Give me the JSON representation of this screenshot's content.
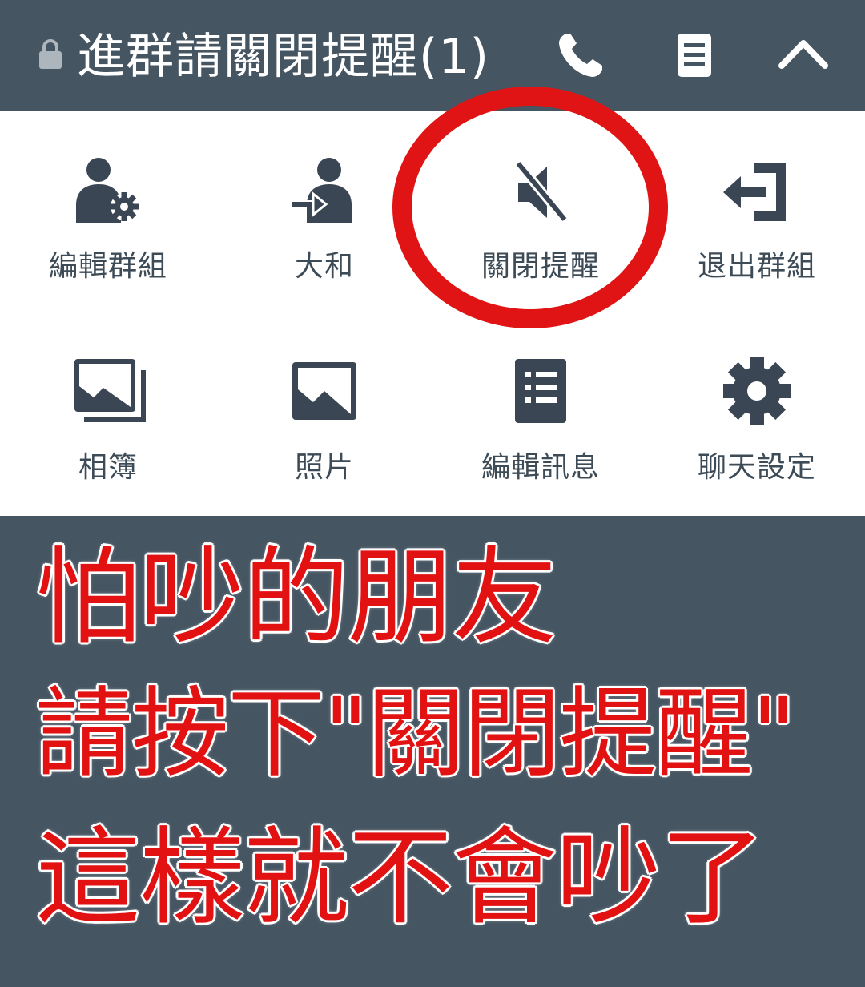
{
  "header": {
    "title": "進群請關閉提醒(1)",
    "icons": [
      "lock-icon",
      "phone-icon",
      "notes-icon",
      "caret-up-icon"
    ]
  },
  "menu": {
    "items": [
      {
        "label": "編輯群組",
        "icon": "edit-group-icon"
      },
      {
        "label": "大和",
        "icon": "invite-person-icon"
      },
      {
        "label": "關閉提醒",
        "icon": "mute-icon"
      },
      {
        "label": "退出群組",
        "icon": "exit-group-icon"
      },
      {
        "label": "相簿",
        "icon": "albums-icon"
      },
      {
        "label": "照片",
        "icon": "photo-icon"
      },
      {
        "label": "編輯訊息",
        "icon": "edit-messages-icon"
      },
      {
        "label": "聊天設定",
        "icon": "settings-gear-icon"
      }
    ]
  },
  "annotation": {
    "lines": [
      "怕吵的朋友",
      "請按下\"關閉提醒\"",
      "這樣就不會吵了"
    ],
    "text_color": "#e31212",
    "circle_color": "#e01414"
  },
  "colors": {
    "header_bg": "#455562",
    "panel_bg": "#ffffff",
    "icon_color": "#3a4654"
  }
}
